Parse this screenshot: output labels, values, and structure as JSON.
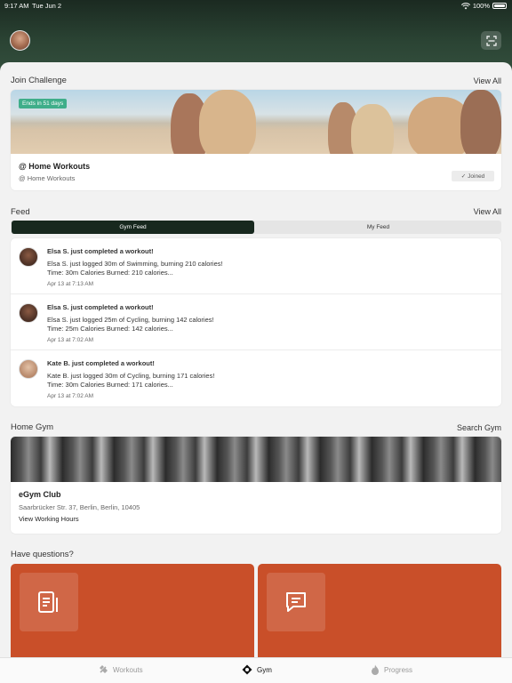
{
  "status_bar": {
    "time": "9:17 AM",
    "date": "Tue Jun 2",
    "battery": "100%"
  },
  "header": {
    "avatar_icon": "user-avatar",
    "scan_icon": "scan-icon"
  },
  "challenge_section": {
    "title": "Join Challenge",
    "view_all": "View All",
    "badge": "Ends in 51 days",
    "name": "@ Home Workouts",
    "subtitle": "@ Home Workouts",
    "joined_label": "Joined"
  },
  "feed_section": {
    "title": "Feed",
    "view_all": "View All",
    "tabs": [
      {
        "label": "Gym Feed",
        "active": true
      },
      {
        "label": "My Feed",
        "active": false
      }
    ],
    "items": [
      {
        "title": "Elsa S. just completed a workout!",
        "line1": "Elsa S. just logged 30m of Swimming, burning 210 calories!",
        "line2": "Time: 30m  Calories Burned: 210 calories...",
        "time": "Apr 13 at 7:13 AM"
      },
      {
        "title": "Elsa S. just completed a workout!",
        "line1": "Elsa S. just logged 25m of Cycling, burning 142 calories!",
        "line2": "Time: 25m  Calories Burned: 142 calories...",
        "time": "Apr 13 at 7:02 AM"
      },
      {
        "title": "Kate B. just completed a workout!",
        "line1": "Kate B. just logged 30m of Cycling, burning 171 calories!",
        "line2": "Time: 30m  Calories Burned: 171 calories...",
        "time": "Apr 13 at 7:02 AM"
      }
    ]
  },
  "gym_section": {
    "title": "Home Gym",
    "search": "Search Gym",
    "name": "eGym Club",
    "address": "Saarbrücker Str. 37, Berlin, Berlin, 10405",
    "hours_link": "View Working Hours"
  },
  "questions_section": {
    "title": "Have questions?",
    "card_icons": [
      "document-icon",
      "chat-icon"
    ]
  },
  "tabbar": {
    "tabs": [
      {
        "label": "Workouts",
        "icon": "dumbbell-icon",
        "active": false
      },
      {
        "label": "Gym",
        "icon": "gym-icon",
        "active": true
      },
      {
        "label": "Progress",
        "icon": "flame-icon",
        "active": false
      }
    ]
  },
  "colors": {
    "header": "#2b4434",
    "accent": "#17281e",
    "badge": "#3fae8a",
    "question_card": "#c94f29"
  }
}
